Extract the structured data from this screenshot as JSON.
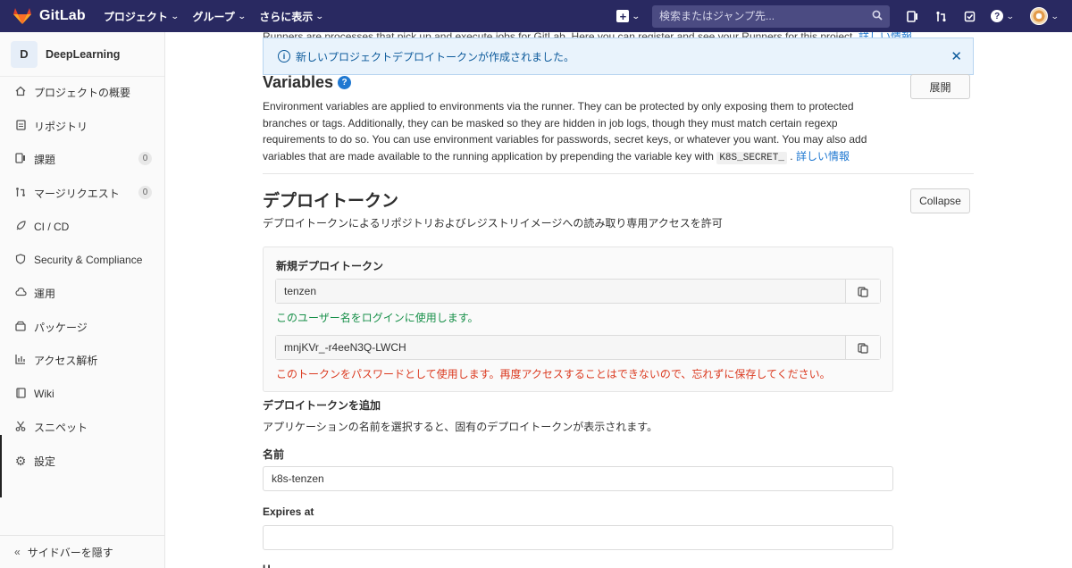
{
  "nav": {
    "app_name": "GitLab",
    "menu": [
      {
        "label": "プロジェクト",
        "icon": "chevron-down-icon"
      },
      {
        "label": "グループ",
        "icon": "chevron-down-icon"
      },
      {
        "label": "さらに表示",
        "icon": "chevron-down-icon"
      }
    ],
    "search_placeholder": "検索またはジャンプ先...",
    "colors": {
      "bar": "#292961",
      "search": "#4b4b82"
    }
  },
  "sidebar": {
    "project_initial": "D",
    "project_name": "DeepLearning",
    "items": [
      {
        "label": "プロジェクトの概要",
        "icon": "home-icon"
      },
      {
        "label": "リポジトリ",
        "icon": "document-icon"
      },
      {
        "label": "課題",
        "icon": "issues-icon",
        "count": "0"
      },
      {
        "label": "マージリクエスト",
        "icon": "merge-request-icon",
        "count": "0"
      },
      {
        "label": "CI / CD",
        "icon": "rocket-icon"
      },
      {
        "label": "Security & Compliance",
        "icon": "shield-icon"
      },
      {
        "label": "運用",
        "icon": "cloud-icon"
      },
      {
        "label": "パッケージ",
        "icon": "package-icon"
      },
      {
        "label": "アクセス解析",
        "icon": "chart-icon"
      },
      {
        "label": "Wiki",
        "icon": "book-icon"
      },
      {
        "label": "スニペット",
        "icon": "scissors-icon"
      },
      {
        "label": "設定",
        "icon": "gear-icon"
      }
    ],
    "collapse_label": "サイドバーを隠す"
  },
  "main": {
    "runners_text": "Runners are processes that pick up and execute jobs for GitLab. Here you can register and see your Runners for this project.",
    "runners_link": "詳しい情報",
    "flash": "新しいプロジェクトデプロイトークンが作成されました。",
    "variables": {
      "title": "Variables",
      "expand_label": "展開",
      "desc": "Environment variables are applied to environments via the runner. They can be protected by only exposing them to protected branches or tags. Additionally, they can be masked so they are hidden in job logs, though they must match certain regexp requirements to do so. You can use environment variables for passwords, secret keys, or whatever you want. You may also add variables that are made available to the running application by prepending the variable key with",
      "code": "K8S_SECRET_",
      "dot": ".",
      "link": "詳しい情報"
    },
    "deploy": {
      "title": "デプロイトークン",
      "collapse_label": "Collapse",
      "subtitle": "デプロイトークンによるリポジトリおよびレジストリイメージへの読み取り専用アクセスを許可",
      "new_token_title": "新規デプロイトークン",
      "username": "tenzen",
      "username_note": "このユーザー名をログインに使用します。",
      "token": "mnjKVr_-r4eeN3Q-LWCH",
      "token_note": "このトークンをパスワードとして使用します。再度アクセスすることはできないので、忘れずに保存してください。",
      "add_title": "デプロイトークンを追加",
      "add_subtitle": "アプリケーションの名前を選択すると、固有のデプロイトークンが表示されます。",
      "name_label": "名前",
      "name_value": "k8s-tenzen",
      "expires_label": "Expires at",
      "expires_value": "",
      "next_label_cut": "U"
    }
  }
}
